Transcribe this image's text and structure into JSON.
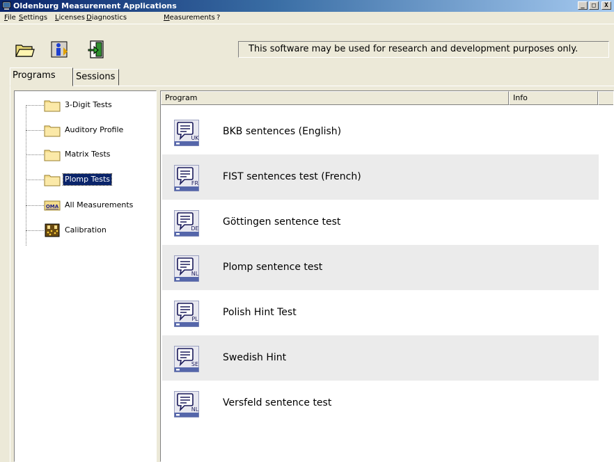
{
  "window": {
    "title": "Oldenburg Measurement Applications",
    "controls": {
      "minimize": "_",
      "maximize": "□",
      "close": "X"
    }
  },
  "menubar": {
    "items": [
      "File",
      "Settings",
      "Licenses",
      "Diagnostics",
      "Measurements",
      "?"
    ]
  },
  "toolbar": {
    "buttons": [
      "open-folder-icon",
      "info-icon",
      "exit-icon"
    ],
    "notice": "This software may be used for research and development purposes only."
  },
  "tabs": [
    "Programs",
    "Sessions"
  ],
  "active_tab": "Programs",
  "tree": {
    "items": [
      {
        "label": "3-Digit Tests",
        "icon": "folder-icon"
      },
      {
        "label": "Auditory Profile",
        "icon": "folder-icon"
      },
      {
        "label": "Matrix Tests",
        "icon": "folder-icon"
      },
      {
        "label": "Plomp Tests",
        "icon": "folder-icon"
      },
      {
        "label": "All Measurements",
        "icon": "oma-icon",
        "badge": "OMA"
      },
      {
        "label": "Calibration",
        "icon": "calibration-icon"
      }
    ],
    "selected": "Plomp Tests"
  },
  "list": {
    "columns": [
      "Program",
      "Info"
    ],
    "rows": [
      {
        "name": "BKB sentences (English)",
        "lang": "UK"
      },
      {
        "name": "FIST sentences test (French)",
        "lang": "FR"
      },
      {
        "name": "Göttingen sentence test",
        "lang": "DE"
      },
      {
        "name": "Plomp sentence test",
        "lang": "NL"
      },
      {
        "name": "Polish Hint Test",
        "lang": "PL"
      },
      {
        "name": "Swedish Hint",
        "lang": "SE"
      },
      {
        "name": "Versfeld sentence test",
        "lang": "NL"
      }
    ]
  },
  "colors": {
    "title_gradient_start": "#0a246a",
    "selection": "#0a246a",
    "row_shade": "#ebebeb",
    "window_bg": "#ece9d8"
  }
}
